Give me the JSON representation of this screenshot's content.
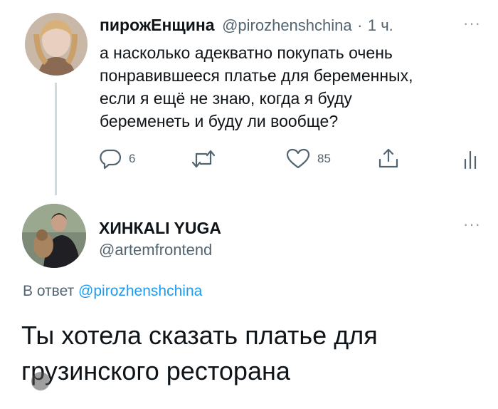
{
  "tweet1": {
    "display_name": "пирожЕнщина",
    "handle": "@pirozhenshchina",
    "separator": "·",
    "time": "1 ч.",
    "more_label": "···",
    "text_lines": [
      "а насколько адекватно покупать очень",
      "понравившееся платье для беременных,",
      "если я ещё не знаю, когда я буду",
      "беременеть и буду ли вообще?"
    ],
    "reply_count": "6",
    "retweet_count": "",
    "like_count": "85"
  },
  "tweet2": {
    "display_name": "ХИНКALI YUGA",
    "handle": "@artemfrontend",
    "more_label": "···",
    "reply_prefix": "В ответ",
    "reply_handle": "@pirozhenshchina",
    "text_lines": [
      "Ты хотела сказать платье для",
      "грузинского ресторана"
    ]
  },
  "colors": {
    "accent": "#1d9bf0",
    "text": "#0f1419",
    "muted": "#536471",
    "thread_line": "#cfd9de"
  }
}
